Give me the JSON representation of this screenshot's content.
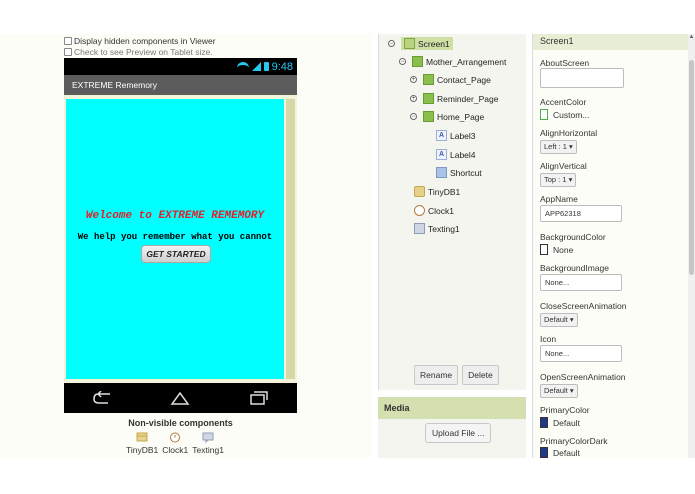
{
  "viewer": {
    "show_hidden_label": "Display hidden components in Viewer",
    "tablet_preview_label": "Check to see Preview on Tablet size.",
    "status_time": "9:48",
    "app_title": "EXTREME Rememory",
    "welcome_text": "Welcome to EXTREME REMEMORY",
    "tagline": "We help you remember what you cannot",
    "start_button": "GET STARTED",
    "canvas_color": "#00ffff",
    "nonvisible_title": "Non-visible components",
    "nonvisible_items": [
      "TinyDB1",
      "Clock1",
      "Texting1"
    ]
  },
  "components": {
    "screen": "Screen1",
    "mother": "Mother_Arrangement",
    "contact": "Contact_Page",
    "reminder": "Reminder_Page",
    "home": "Home_Page",
    "label3": "Label3",
    "label4": "Label4",
    "shortcut": "Shortcut",
    "tinydb": "TinyDB1",
    "clock": "Clock1",
    "texting": "Texting1",
    "rename_button": "Rename",
    "delete_button": "Delete"
  },
  "media": {
    "title": "Media",
    "upload_button": "Upload File ..."
  },
  "properties": {
    "header": "Screen1",
    "about_label": "AboutScreen",
    "about_value": "",
    "accent_label": "AccentColor",
    "accent_value": "Custom...",
    "align_h_label": "AlignHorizontal",
    "align_h_value": "Left : 1 ▾",
    "align_v_label": "AlignVertical",
    "align_v_value": "Top : 1 ▾",
    "appname_label": "AppName",
    "appname_value": "APP62318",
    "bgcolor_label": "BackgroundColor",
    "bgcolor_value": "None",
    "bgimage_label": "BackgroundImage",
    "bgimage_value": "None...",
    "close_anim_label": "CloseScreenAnimation",
    "close_anim_value": "Default ▾",
    "icon_label": "Icon",
    "icon_value": "None...",
    "open_anim_label": "OpenScreenAnimation",
    "open_anim_value": "Default ▾",
    "primary_label": "PrimaryColor",
    "primary_value": "Default",
    "primary_dark_label": "PrimaryColorDark",
    "primary_dark_value": "Default",
    "primary_swatch_color": "#1f3a8a"
  }
}
